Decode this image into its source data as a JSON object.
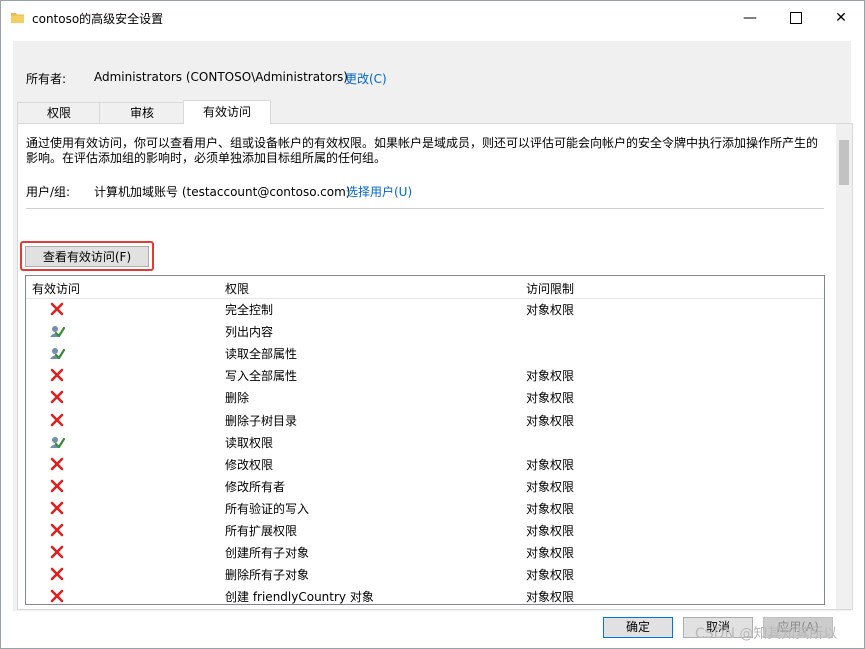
{
  "window": {
    "title": "contoso的高级安全设置"
  },
  "owner": {
    "label": "所有者:",
    "value": "Administrators (CONTOSO\\Administrators)",
    "change_link": "更改(C)"
  },
  "tabs": [
    {
      "label": "权限"
    },
    {
      "label": "审核"
    },
    {
      "label": "有效访问",
      "active": true
    }
  ],
  "effective_access": {
    "description": "通过使用有效访问，你可以查看用户、组或设备帐户的有效权限。如果帐户是域成员，则还可以评估可能会向帐户的安全令牌中执行添加操作所产生的影响。在评估添加组的影响时，必须单独添加目标组所属的任何组。",
    "user_label": "用户/组:",
    "user_value": "计算机加域账号 (testaccount@contoso.com)",
    "select_user_link": "选择用户(U)",
    "view_button": "查看有效访问(F)",
    "columns": [
      "有效访问",
      "权限",
      "访问限制"
    ],
    "rows": [
      {
        "access": "deny",
        "permission": "完全控制",
        "limit": "对象权限"
      },
      {
        "access": "allow",
        "permission": "列出内容",
        "limit": ""
      },
      {
        "access": "allow",
        "permission": "读取全部属性",
        "limit": ""
      },
      {
        "access": "deny",
        "permission": "写入全部属性",
        "limit": "对象权限"
      },
      {
        "access": "deny",
        "permission": "删除",
        "limit": "对象权限"
      },
      {
        "access": "deny",
        "permission": "删除子树目录",
        "limit": "对象权限"
      },
      {
        "access": "allow",
        "permission": "读取权限",
        "limit": ""
      },
      {
        "access": "deny",
        "permission": "修改权限",
        "limit": "对象权限"
      },
      {
        "access": "deny",
        "permission": "修改所有者",
        "limit": "对象权限"
      },
      {
        "access": "deny",
        "permission": "所有验证的写入",
        "limit": "对象权限"
      },
      {
        "access": "deny",
        "permission": "所有扩展权限",
        "limit": "对象权限"
      },
      {
        "access": "deny",
        "permission": "创建所有子对象",
        "limit": "对象权限"
      },
      {
        "access": "deny",
        "permission": "删除所有子对象",
        "limit": "对象权限"
      },
      {
        "access": "deny",
        "permission": "创建 friendlyCountry 对象",
        "limit": "对象权限"
      }
    ]
  },
  "buttons": {
    "ok": "确定",
    "cancel": "取消",
    "apply": "应用(A)"
  },
  "watermark": "CSDN @知其知其所以",
  "icons": {
    "deny": "red-x-icon",
    "allow": "user-check-icon",
    "folder": "folder-icon"
  },
  "colors": {
    "highlight_border": "#e53935",
    "link": "#0066cc",
    "deny": "#e02020",
    "allow": "#3a8a3a"
  }
}
